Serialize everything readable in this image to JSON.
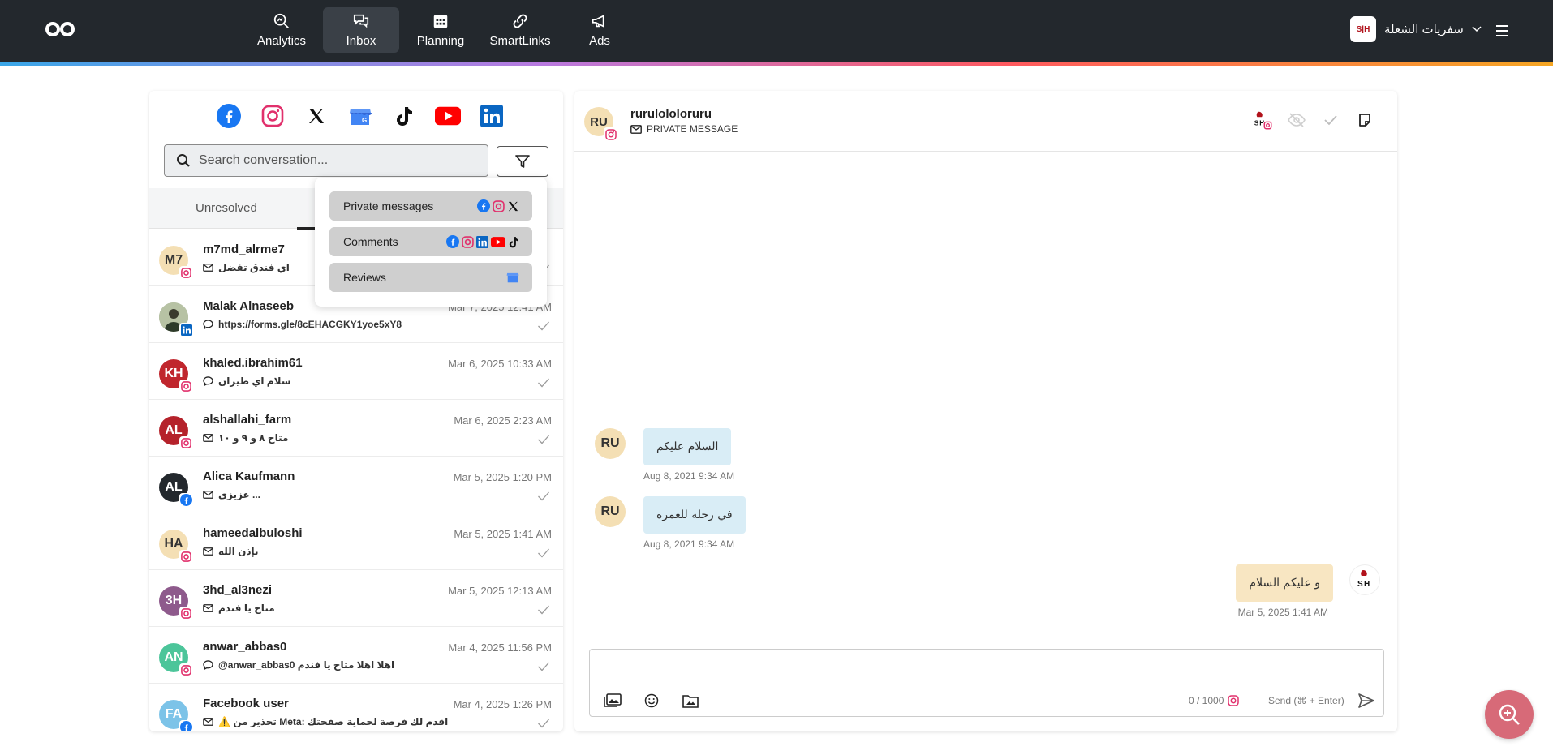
{
  "nav": {
    "items": [
      {
        "label": "Analytics",
        "icon": "analytics-icon"
      },
      {
        "label": "Inbox",
        "icon": "inbox-icon",
        "active": true
      },
      {
        "label": "Planning",
        "icon": "calendar-icon"
      },
      {
        "label": "SmartLinks",
        "icon": "link-icon"
      },
      {
        "label": "Ads",
        "icon": "megaphone-icon"
      }
    ],
    "account_name": "سفريات الشعلة",
    "account_logo": "S|H"
  },
  "search": {
    "placeholder": "Search conversation..."
  },
  "tabs": {
    "unresolved": "Unresolved"
  },
  "filter_menu": {
    "private_messages": "Private messages",
    "comments": "Comments",
    "reviews": "Reviews"
  },
  "conversations": [
    {
      "initials": "M7",
      "name": "m7md_alrme7",
      "date": "",
      "preview": "اي فندق تفضل",
      "type": "message",
      "network": "instagram",
      "avatar_color": "#f4dfb4",
      "text_color": "#333"
    },
    {
      "initials": "",
      "name": "Malak Alnaseeb",
      "date": "Mar 7, 2025 12:41 AM",
      "preview": "https://forms.gle/8cEHACGKY1yoe5xY8",
      "type": "comment",
      "network": "linkedin",
      "avatar_color": "#9aa88a",
      "text_color": "#fff"
    },
    {
      "initials": "KH",
      "name": "khaled.ibrahim61",
      "date": "Mar 6, 2025 10:33 AM",
      "preview": "سلام اي طيران",
      "type": "comment",
      "network": "instagram",
      "avatar_color": "#c0262d",
      "text_color": "#fff"
    },
    {
      "initials": "AL",
      "name": "alshallahi_farm",
      "date": "Mar 6, 2025 2:23 AM",
      "preview": "متاح ٨ و ٩ و ١٠",
      "type": "message",
      "network": "instagram",
      "avatar_color": "#b5222b",
      "text_color": "#fff"
    },
    {
      "initials": "AL",
      "name": "Alica Kaufmann",
      "date": "Mar 5, 2025 1:20 PM",
      "preview": "عزيزي ...",
      "type": "message",
      "network": "facebook",
      "avatar_color": "#23282d",
      "text_color": "#fff"
    },
    {
      "initials": "HA",
      "name": "hameedalbuloshi",
      "date": "Mar 5, 2025 1:41 AM",
      "preview": "بإذن الله",
      "type": "message",
      "network": "instagram",
      "avatar_color": "#f4dfb4",
      "text_color": "#333"
    },
    {
      "initials": "3H",
      "name": "3hd_al3nezi",
      "date": "Mar 5, 2025 12:13 AM",
      "preview": "متاح يا فندم",
      "type": "message",
      "network": "instagram",
      "avatar_color": "#8e5a8c",
      "text_color": "#fff"
    },
    {
      "initials": "AN",
      "name": "anwar_abbas0",
      "date": "Mar 4, 2025 11:56 PM",
      "preview": "@anwar_abbas0 اهلا اهلا متاح يا فندم",
      "type": "comment",
      "network": "instagram",
      "avatar_color": "#4cc59a",
      "text_color": "#fff"
    },
    {
      "initials": "FA",
      "name": "Facebook user",
      "date": "Mar 4, 2025 1:26 PM",
      "preview": "⚠️ تحذير من Meta: اقدم لك فرصة لحماية صفحتك",
      "type": "message",
      "network": "facebook",
      "avatar_color": "#7cc3e8",
      "text_color": "#fff"
    }
  ],
  "chat": {
    "initials": "RU",
    "name": "rurulololoruru",
    "subtitle": "PRIVATE MESSAGE",
    "messages": [
      {
        "direction": "in",
        "text": "السلام عليكم",
        "time": "Aug 8, 2021 9:34 AM"
      },
      {
        "direction": "in",
        "text": "في رحله للعمره",
        "time": "Aug 8, 2021 9:34 AM"
      },
      {
        "direction": "out",
        "text": "و عليكم السلام",
        "time": "Mar 5, 2025 1:41 AM"
      }
    ]
  },
  "composer": {
    "counter": "0 / 1000",
    "send_label": "Send (⌘ + Enter)"
  },
  "colors": {
    "topbar": "#23282d",
    "facebook": "#1877f2",
    "instagram": "#e1306c",
    "linkedin": "#0a66c2",
    "youtube": "#ff0000",
    "fab": "#d76a78"
  }
}
